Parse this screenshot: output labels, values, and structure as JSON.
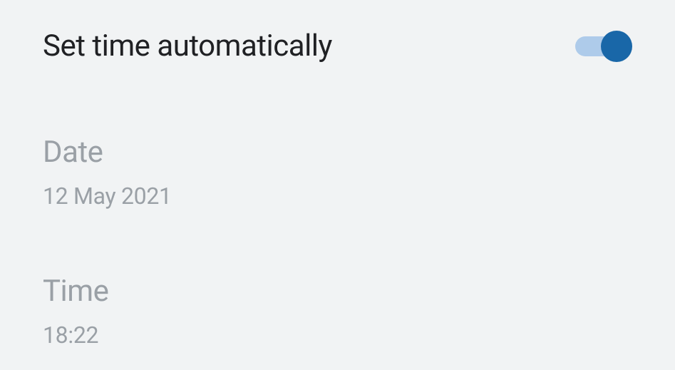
{
  "autoTime": {
    "title": "Set time automatically",
    "enabled": true
  },
  "date": {
    "label": "Date",
    "value": "12 May 2021"
  },
  "time": {
    "label": "Time",
    "value": "18:22"
  }
}
